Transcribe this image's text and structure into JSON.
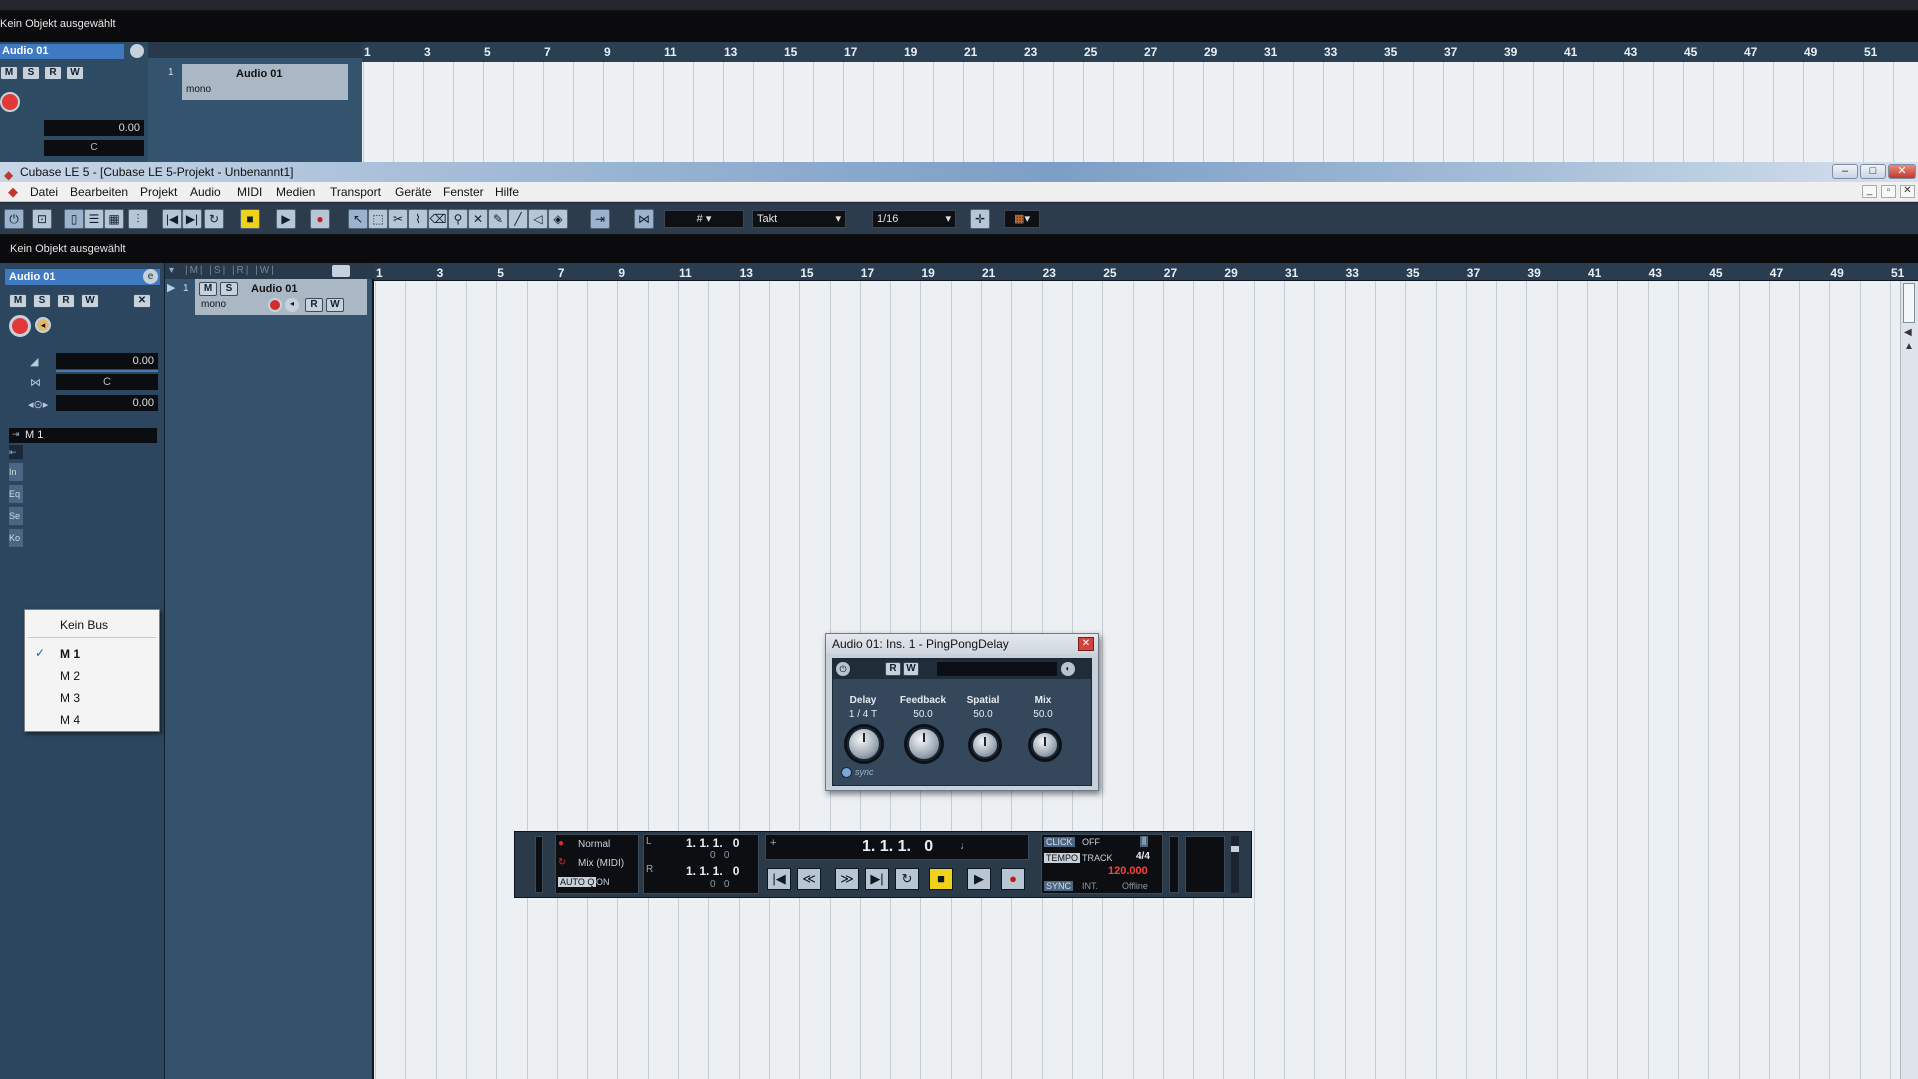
{
  "back_window": {
    "status": "Kein Objekt ausgewählt",
    "track_name": "Audio 01",
    "track_number": "1",
    "track_mode": "mono",
    "volume": "0.00",
    "pan": "C"
  },
  "window": {
    "title": "Cubase LE 5 - [Cubase LE 5-Projekt - Unbenannt1]",
    "controls": [
      "–",
      "□",
      "✕"
    ]
  },
  "menu": {
    "items": [
      "Datei",
      "Bearbeiten",
      "Projekt",
      "Audio",
      "MIDI",
      "Medien",
      "Transport",
      "Geräte",
      "Fenster",
      "Hilfe"
    ],
    "doc_controls": [
      "_",
      "▫",
      "✕"
    ]
  },
  "toolbar": {
    "grid_type": "Takt",
    "quantize": "1/16"
  },
  "status": "Kein Objekt ausgewählt",
  "inspector": {
    "track_name": "Audio 01",
    "buttons": [
      "M",
      "S",
      "R",
      "W"
    ],
    "volume": "0.00",
    "pan": "C",
    "delay": "0.00",
    "output_bus": "M 1",
    "side_tabs": [
      "In",
      "Eq",
      "Se",
      "Ko"
    ]
  },
  "bus_menu": {
    "options": [
      "Kein Bus",
      "M 1",
      "M 2",
      "M 3",
      "M 4"
    ],
    "selected": "M 1",
    "check": "✓"
  },
  "track": {
    "number": "1",
    "name": "Audio 01",
    "mode": "mono",
    "buttons": [
      "M",
      "S",
      "R",
      "W"
    ]
  },
  "ruler": {
    "bars": [
      "1",
      "3",
      "5",
      "7",
      "9",
      "11",
      "13",
      "15",
      "17",
      "19",
      "21",
      "23",
      "25",
      "27",
      "29",
      "31",
      "33",
      "35",
      "37",
      "39",
      "41",
      "43",
      "45",
      "47",
      "49",
      "51"
    ]
  },
  "plugin": {
    "title": "Audio 01: Ins. 1 - PingPongDelay",
    "buttons": [
      "R",
      "W"
    ],
    "params": [
      {
        "label": "Delay",
        "value": "1 / 4 T"
      },
      {
        "label": "Feedback",
        "value": "50.0"
      },
      {
        "label": "Spatial",
        "value": "50.0"
      },
      {
        "label": "Mix",
        "value": "50.0"
      }
    ],
    "sync_label": "sync"
  },
  "transport": {
    "record_mode": "Normal",
    "cycle_mode": "Mix (MIDI)",
    "auto_label": "AUTO Q",
    "auto_value": "ON",
    "left_locator": "1. 1. 1.   0",
    "left_sub": "0   0",
    "right_locator": "1. 1. 1.   0",
    "right_sub": "0   0",
    "position": "1. 1. 1.   0",
    "click_label": "CLICK",
    "click_value": "OFF",
    "tempo_label": "TEMPO",
    "tempo_mode": "TRACK",
    "signature": "4/4",
    "tempo": "120.000",
    "sync_label": "SYNC",
    "sync_mode": "INT.",
    "sync_status": "Offline"
  },
  "colors": {
    "accent": "#3f79c2",
    "record": "#c81818",
    "stop_active": "#f0d21a",
    "tempo_value": "#ff4040"
  }
}
